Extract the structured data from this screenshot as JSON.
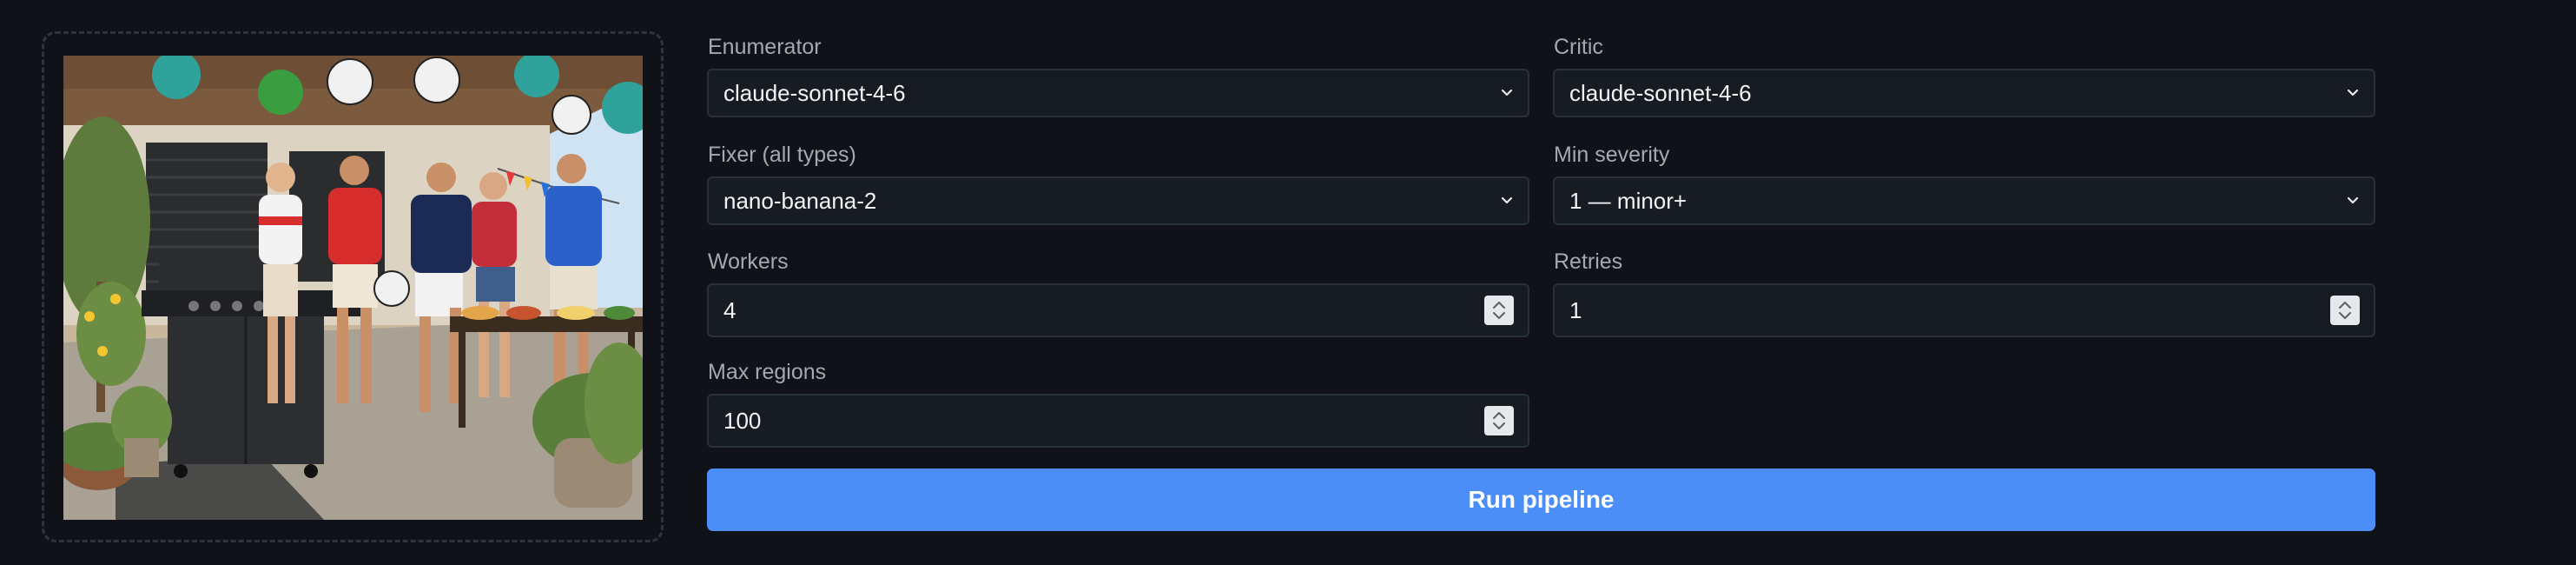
{
  "form": {
    "enumerator": {
      "label": "Enumerator",
      "value": "claude-sonnet-4-6"
    },
    "critic": {
      "label": "Critic",
      "value": "claude-sonnet-4-6"
    },
    "fixer": {
      "label": "Fixer (all types)",
      "value": "nano-banana-2"
    },
    "min_severity": {
      "label": "Min severity",
      "value": "1 — minor+"
    },
    "workers": {
      "label": "Workers",
      "value": "4"
    },
    "retries": {
      "label": "Retries",
      "value": "1"
    },
    "max_regions": {
      "label": "Max regions",
      "value": "100"
    }
  },
  "actions": {
    "run_label": "Run pipeline"
  },
  "icons": {
    "select_arrow": "chevron-down-icon",
    "number_stepper": "stepper-icon"
  },
  "colors": {
    "background": "#101217",
    "field_background": "#171b22",
    "field_border": "#2a3038",
    "label_text": "#a3a9b2",
    "primary_button": "#4b8ef8"
  }
}
